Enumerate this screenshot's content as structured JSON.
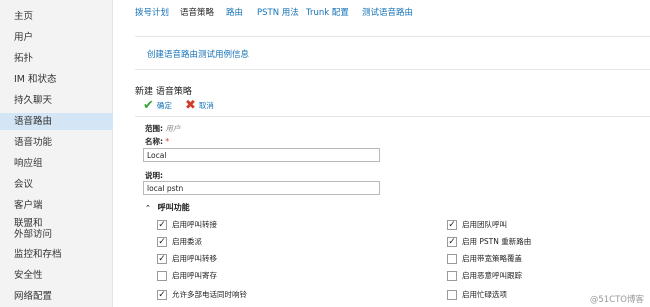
{
  "sidebar": {
    "items": [
      {
        "label": "主页",
        "active": false
      },
      {
        "label": "用户",
        "active": false
      },
      {
        "label": "拓扑",
        "active": false
      },
      {
        "label": "IM 和状态",
        "active": false
      },
      {
        "label": "持久聊天",
        "active": false
      },
      {
        "label": "语音路由",
        "active": true
      },
      {
        "label": "语音功能",
        "active": false
      },
      {
        "label": "响应组",
        "active": false
      },
      {
        "label": "会议",
        "active": false
      },
      {
        "label": "客户端",
        "active": false
      },
      {
        "label": "联盟和\n外部访问",
        "active": false
      },
      {
        "label": "监控和存档",
        "active": false
      },
      {
        "label": "安全性",
        "active": false
      },
      {
        "label": "网络配置",
        "active": false
      }
    ]
  },
  "tabs": [
    {
      "label": "拨号计划",
      "active": false
    },
    {
      "label": "语音策略",
      "active": true
    },
    {
      "label": "路由",
      "active": false
    },
    {
      "label": "PSTN 用法",
      "active": false
    },
    {
      "label": "Trunk 配置",
      "active": false
    },
    {
      "label": "测试语音路由",
      "active": false
    }
  ],
  "info": {
    "link": "创建语音路由测试用例信息"
  },
  "form": {
    "title": "新建 语音策略",
    "ok_label": "确定",
    "cancel_label": "取消",
    "scope_label": "范围:",
    "scope_value": "用户",
    "name_label": "名称:",
    "required_mark": "*",
    "name_value": "Local",
    "desc_label": "说明:",
    "desc_value": "local pstn",
    "section_title": "呼叫功能"
  },
  "checkboxes_left": [
    {
      "label": "启用呼叫转接",
      "checked": true
    },
    {
      "label": "启用委派",
      "checked": true
    },
    {
      "label": "启用呼叫转移",
      "checked": true
    },
    {
      "label": "启用呼叫寄存",
      "checked": false
    },
    {
      "label": "允许多部电话同时响铃",
      "checked": true
    }
  ],
  "checkboxes_right": [
    {
      "label": "启用团队呼叫",
      "checked": true
    },
    {
      "label": "启用 PSTN 重新路由",
      "checked": true
    },
    {
      "label": "启用带宽策略覆盖",
      "checked": false
    },
    {
      "label": "启用恶意呼叫跟踪",
      "checked": false
    },
    {
      "label": "启用忙碌选项",
      "checked": false
    }
  ],
  "watermark": "@51CTO博客"
}
